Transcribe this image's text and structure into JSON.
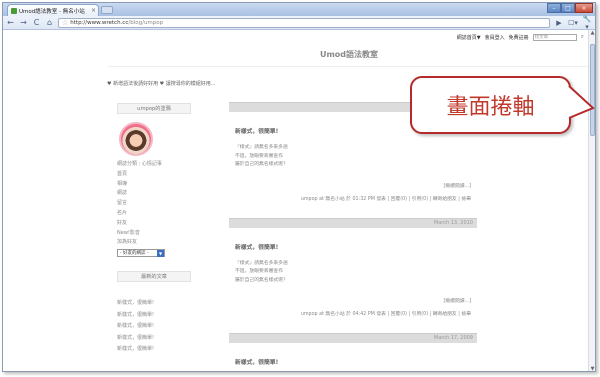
{
  "browser": {
    "tab_title": "Umod語法教室 - 無名小站",
    "tab_close": "×",
    "window_buttons": {
      "minimize": "–",
      "maximize": "□",
      "close": "×"
    },
    "nav": {
      "back": "←",
      "forward": "→",
      "reload": "C",
      "home": "⌂"
    },
    "url_host": "http://www.wretch.cc",
    "url_path": "/blog/umpop",
    "toolbar_icons": {
      "go": "▶",
      "page": "☐▾",
      "tools": "🔧▾"
    }
  },
  "page": {
    "topnav": [
      "網誌首頁▼",
      "會員登入",
      "免費註冊"
    ],
    "search_placeholder": "找文章",
    "site_title": "Umod語法教室",
    "tagline": "♥ 新增語法後請好好用 ♥ 讓搜尋你的模組好用...",
    "sidebar": {
      "profile_head": "umpop的塗鴉",
      "links": [
        "網誌分類 : 心情記事",
        "首頁",
        "相簿",
        "網誌",
        "留言",
        "名片",
        "好友",
        "New!影音",
        "加為好友"
      ],
      "select_value": "- 好友的網誌 -",
      "recent_head": "最新的文章",
      "recent": [
        "新樣式，很簡單!",
        "新樣式，很簡單!",
        "新樣式，很簡單!",
        "新樣式，很簡單!",
        "新樣式，很簡單!"
      ]
    },
    "posts": [
      {
        "date": "",
        "title": "新樣式，很簡單!",
        "lines": [
          "『樣式』請無名多來多語",
          "不過，放眼要丟審查作",
          "屬於自己的無名樣式呢？"
        ],
        "more": "[繼續閱讀...]",
        "footer": "umpop at 無名小站 於 01:32 PM 發表 | 回覆(0) | 引用(0) | 轉寄給朋友 | 檢舉"
      },
      {
        "date": "March 13, 2010",
        "title": "新樣式，很簡單!",
        "lines": [
          "『樣式』請無名多來多語",
          "不過，放眼要丟審查作",
          "屬於自己的無名樣式呢？"
        ],
        "more": "[繼續閱讀...]",
        "footer": "umpop at 無名小站 於 04:42 PM 發表 | 回覆(0) | 引用(0) | 轉寄給朋友 | 檢舉"
      },
      {
        "date": "March 17, 2009",
        "title": "新樣式，很簡單!",
        "lines": [],
        "more": "",
        "footer": ""
      }
    ]
  },
  "callout": {
    "text": "畫面捲軸",
    "border_color": "#b52b2b",
    "text_color": "#c0392b"
  }
}
